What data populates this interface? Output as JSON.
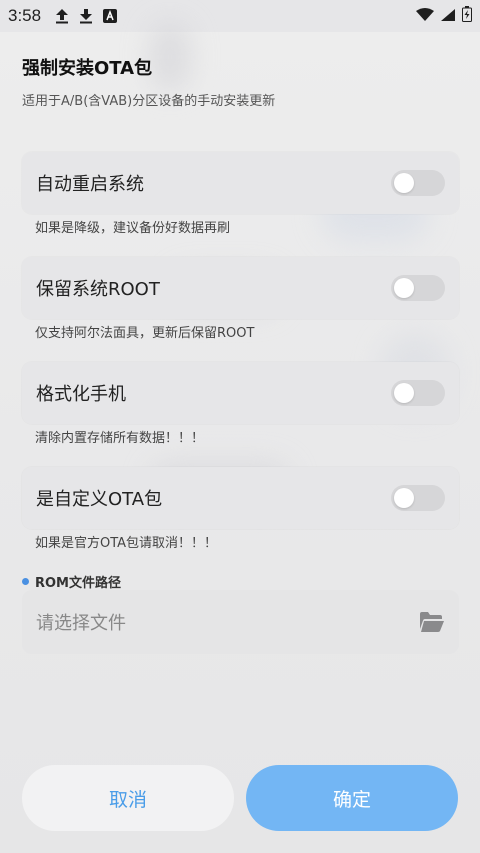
{
  "status_bar": {
    "time": "3:58",
    "icons": [
      "upload-icon",
      "download-icon",
      "app-a-icon"
    ],
    "right_icons": [
      "wifi-icon",
      "signal-icon",
      "battery-charging-icon"
    ]
  },
  "dialog": {
    "title": "强制安装OTA包",
    "subtitle": "适用于A/B(含VAB)分区设备的手动安装更新",
    "options": [
      {
        "label": "自动重启系统",
        "hint": "如果是降级，建议备份好数据再刷",
        "enabled": false
      },
      {
        "label": "保留系统ROOT",
        "hint": "仅支持阿尔法面具，更新后保留ROOT",
        "enabled": false
      },
      {
        "label": "格式化手机",
        "hint": "清除内置存储所有数据！！！",
        "enabled": false
      },
      {
        "label": "是自定义OTA包",
        "hint": "如果是官方OTA包请取消！！！",
        "enabled": false
      }
    ],
    "rom_path": {
      "label": "ROM文件路径",
      "placeholder": "请选择文件",
      "icon": "folder-open-icon"
    },
    "buttons": {
      "cancel": "取消",
      "confirm": "确定"
    }
  },
  "colors": {
    "accent": "#4a9de8",
    "confirm_bg": "#73b6f4",
    "dot": "#4a90e2"
  }
}
